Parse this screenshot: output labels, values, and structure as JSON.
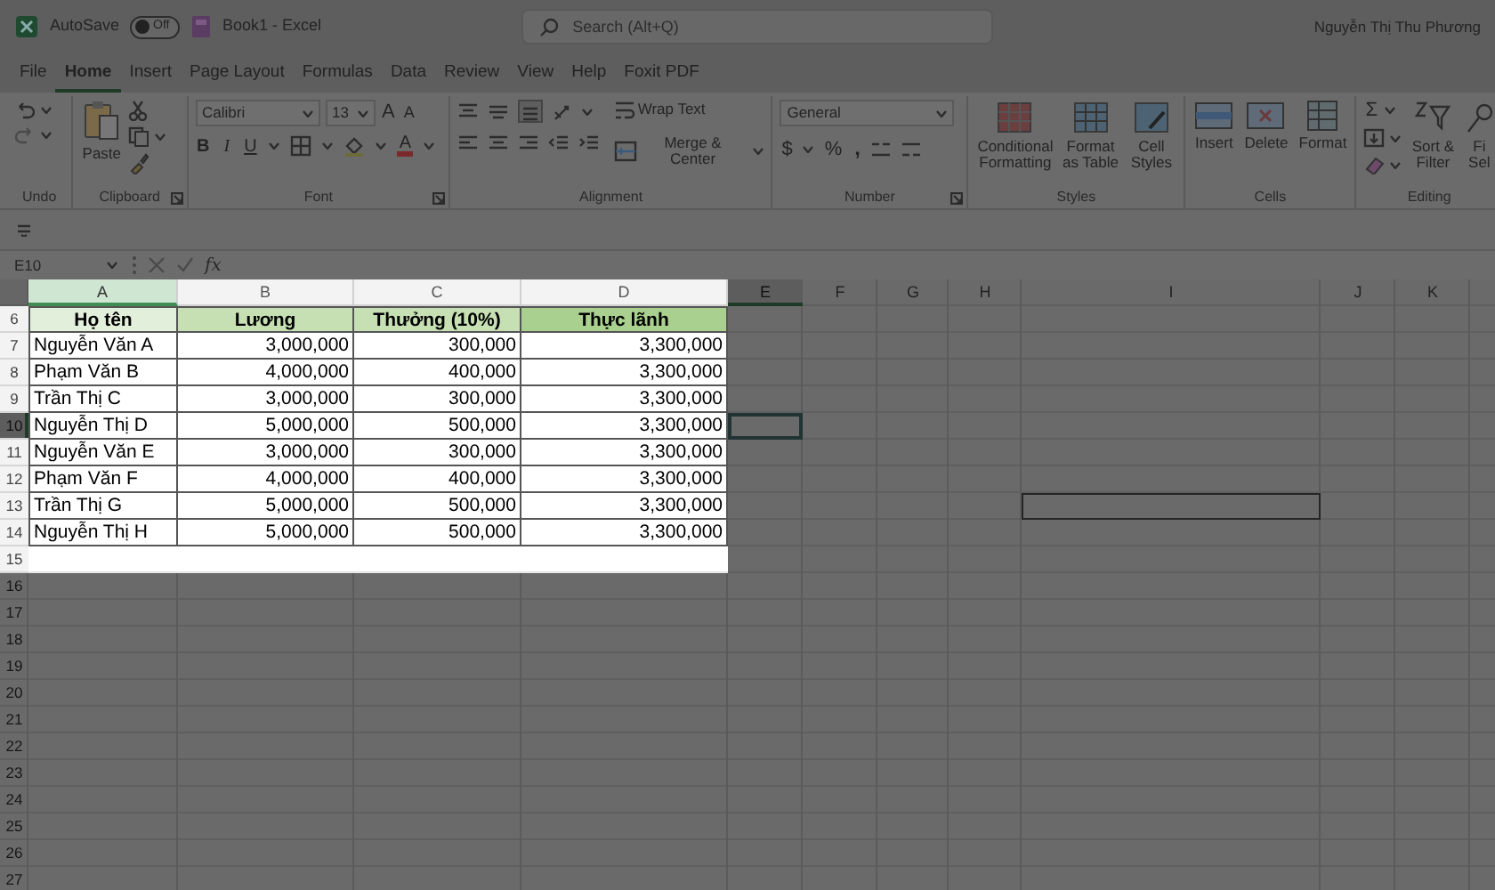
{
  "title_bar": {
    "autosave_label": "AutoSave",
    "autosave_toggle": {
      "label": "Off",
      "on": false
    },
    "document_title": "Book1  -  Excel",
    "search": {
      "placeholder": "Search (Alt+Q)"
    },
    "user_name": "Nguyễn Thị Thu Phương"
  },
  "menu_tabs": [
    {
      "label": "File",
      "selected": false
    },
    {
      "label": "Home",
      "selected": true
    },
    {
      "label": "Insert",
      "selected": false
    },
    {
      "label": "Page Layout",
      "selected": false
    },
    {
      "label": "Formulas",
      "selected": false
    },
    {
      "label": "Data",
      "selected": false
    },
    {
      "label": "Review",
      "selected": false
    },
    {
      "label": "View",
      "selected": false
    },
    {
      "label": "Help",
      "selected": false
    },
    {
      "label": "Foxit PDF",
      "selected": false
    }
  ],
  "ribbon": {
    "undo": {
      "label": "Undo"
    },
    "clipboard": {
      "paste": "Paste",
      "label": "Clipboard"
    },
    "font": {
      "font_name": "Calibri",
      "font_size": "13",
      "grow": "A",
      "shrink": "A",
      "bold": "B",
      "italic": "I",
      "underline": "U",
      "font_color": "A",
      "label": "Font"
    },
    "alignment": {
      "wrap_text": "Wrap Text",
      "merge_center": "Merge & Center",
      "label": "Alignment"
    },
    "number": {
      "format": "General",
      "currency": "$",
      "percent": "%",
      "comma": ",",
      "label": "Number"
    },
    "styles": {
      "conditional": "Conditional Formatting",
      "format_table": "Format as Table",
      "cell_styles": "Cell Styles",
      "label": "Styles"
    },
    "cells": {
      "insert": "Insert",
      "delete": "Delete",
      "format": "Format",
      "label": "Cells"
    },
    "editing": {
      "autosum": "Σ",
      "sort_filter": "Sort & Filter",
      "find_select": "Fi Sel",
      "label": "Editing"
    }
  },
  "formula_bar": {
    "name_box": "E10",
    "fx": "fx"
  },
  "sheet": {
    "columns": [
      {
        "label": "A",
        "selected": true,
        "highlighted": true,
        "has_cursor": false
      },
      {
        "label": "B",
        "selected": false,
        "highlighted": true,
        "has_cursor": false
      },
      {
        "label": "C",
        "selected": false,
        "highlighted": true,
        "has_cursor": false
      },
      {
        "label": "D",
        "selected": false,
        "highlighted": true,
        "has_cursor": false
      },
      {
        "label": "E",
        "selected": false,
        "highlighted": false,
        "has_cursor": true
      },
      {
        "label": "F",
        "selected": false,
        "highlighted": false,
        "has_cursor": false
      },
      {
        "label": "G",
        "selected": false,
        "highlighted": false,
        "has_cursor": false
      },
      {
        "label": "H",
        "selected": false,
        "highlighted": false,
        "has_cursor": false
      },
      {
        "label": "I",
        "selected": false,
        "highlighted": false,
        "has_cursor": false
      },
      {
        "label": "J",
        "selected": false,
        "highlighted": false,
        "has_cursor": false
      },
      {
        "label": "K",
        "selected": false,
        "highlighted": false,
        "has_cursor": false
      }
    ],
    "rows": [
      {
        "number": "6",
        "highlighted": true,
        "has_cursor": false,
        "kind": "header",
        "cells": [
          {
            "text": "Họ tên",
            "color": "#e2efda"
          },
          {
            "text": "Lương",
            "color": "#c6e0b4"
          },
          {
            "text": "Thưởng (10%)",
            "color": "#c6e0b4"
          },
          {
            "text": "Thực lãnh",
            "color": "#a9d08e"
          }
        ]
      },
      {
        "number": "7",
        "highlighted": true,
        "has_cursor": false,
        "kind": "data",
        "cells": [
          {
            "text": "Nguyễn Văn A"
          },
          {
            "text": "3,000,000"
          },
          {
            "text": "300,000"
          },
          {
            "text": "3,300,000"
          }
        ]
      },
      {
        "number": "8",
        "highlighted": true,
        "has_cursor": false,
        "kind": "data",
        "cells": [
          {
            "text": "Phạm Văn B"
          },
          {
            "text": "4,000,000"
          },
          {
            "text": "400,000"
          },
          {
            "text": "3,300,000"
          }
        ]
      },
      {
        "number": "9",
        "highlighted": true,
        "has_cursor": false,
        "kind": "data",
        "cells": [
          {
            "text": "Trần Thị C"
          },
          {
            "text": "3,000,000"
          },
          {
            "text": "300,000"
          },
          {
            "text": "3,300,000"
          }
        ]
      },
      {
        "number": "10",
        "highlighted": true,
        "has_cursor": true,
        "kind": "data",
        "cells": [
          {
            "text": "Nguyễn Thị D"
          },
          {
            "text": "5,000,000"
          },
          {
            "text": "500,000"
          },
          {
            "text": "3,300,000"
          }
        ]
      },
      {
        "number": "11",
        "highlighted": true,
        "has_cursor": false,
        "kind": "data",
        "cells": [
          {
            "text": "Nguyễn Văn E"
          },
          {
            "text": "3,000,000"
          },
          {
            "text": "300,000"
          },
          {
            "text": "3,300,000"
          }
        ]
      },
      {
        "number": "12",
        "highlighted": true,
        "has_cursor": false,
        "kind": "data",
        "cells": [
          {
            "text": "Phạm Văn F"
          },
          {
            "text": "4,000,000"
          },
          {
            "text": "400,000"
          },
          {
            "text": "3,300,000"
          }
        ]
      },
      {
        "number": "13",
        "highlighted": true,
        "has_cursor": false,
        "kind": "data",
        "cells": [
          {
            "text": "Trần Thị G"
          },
          {
            "text": "5,000,000"
          },
          {
            "text": "500,000"
          },
          {
            "text": "3,300,000"
          },
          null,
          null,
          null,
          null,
          {
            "outlined": true
          }
        ]
      },
      {
        "number": "14",
        "highlighted": true,
        "has_cursor": false,
        "kind": "data",
        "cells": [
          {
            "text": "Nguyễn Thị H"
          },
          {
            "text": "5,000,000"
          },
          {
            "text": "500,000"
          },
          {
            "text": "3,300,000"
          }
        ]
      },
      {
        "number": "15",
        "highlighted": true,
        "has_cursor": false
      },
      {
        "number": "16",
        "highlighted": false,
        "has_cursor": false
      },
      {
        "number": "17",
        "highlighted": false,
        "has_cursor": false
      },
      {
        "number": "18",
        "highlighted": false,
        "has_cursor": false
      },
      {
        "number": "19",
        "highlighted": false,
        "has_cursor": false
      },
      {
        "number": "20",
        "highlighted": false,
        "has_cursor": false
      },
      {
        "number": "21",
        "highlighted": false,
        "has_cursor": false
      },
      {
        "number": "22",
        "highlighted": false,
        "has_cursor": false
      },
      {
        "number": "23",
        "highlighted": false,
        "has_cursor": false
      },
      {
        "number": "24",
        "highlighted": false,
        "has_cursor": false
      },
      {
        "number": "25",
        "highlighted": false,
        "has_cursor": false
      },
      {
        "number": "26",
        "highlighted": false,
        "has_cursor": false
      },
      {
        "number": "27",
        "highlighted": false,
        "has_cursor": false
      }
    ]
  }
}
